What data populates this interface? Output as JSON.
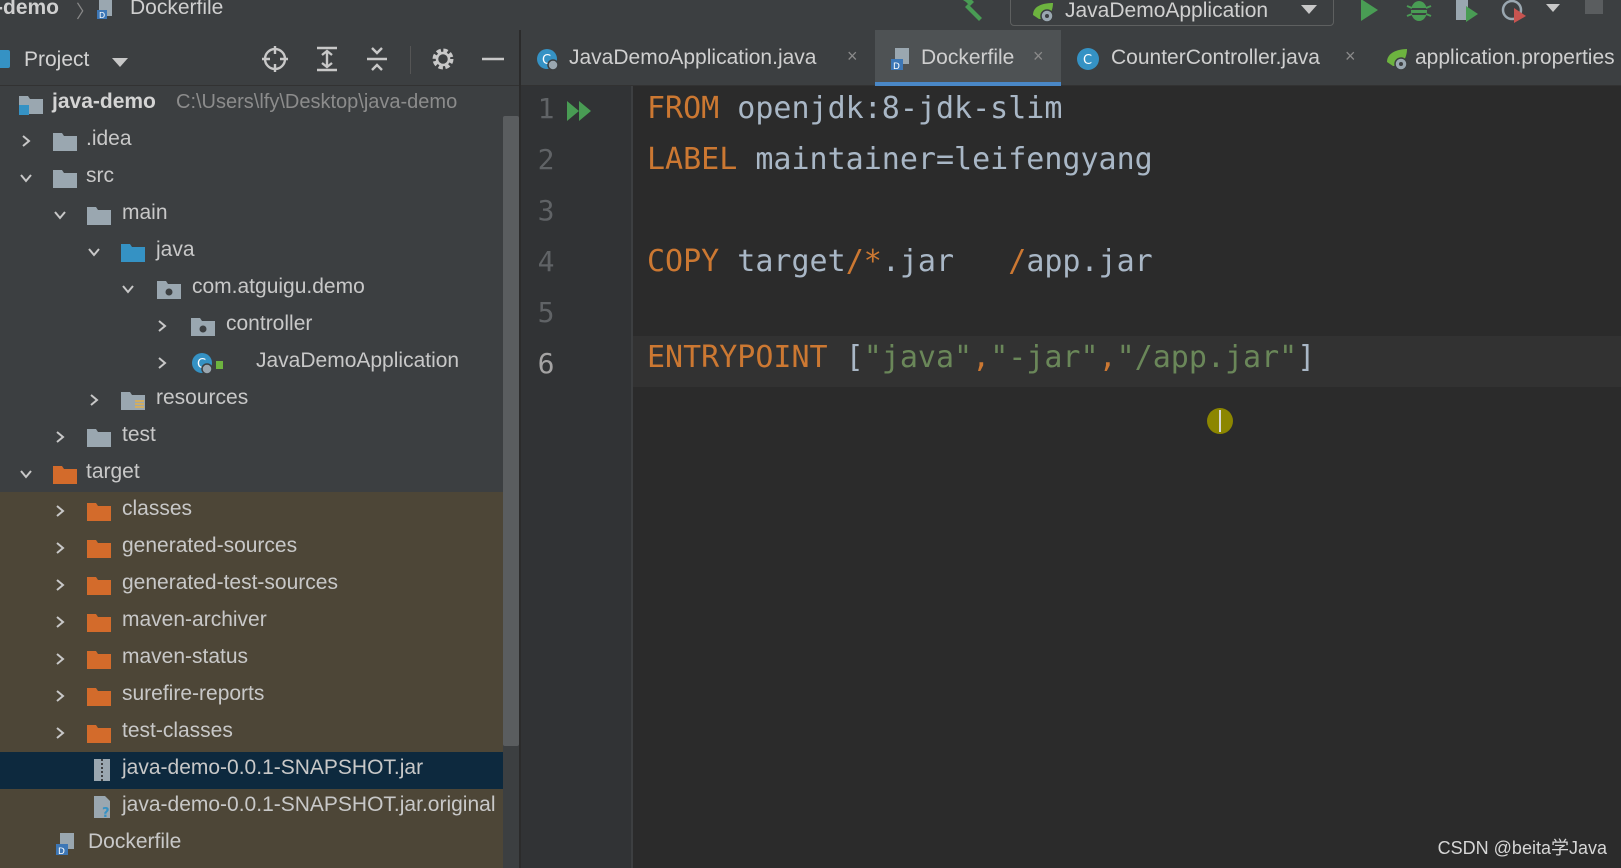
{
  "navbar": {
    "project_crumb": "-demo",
    "file_crumb": "Dockerfile",
    "run_config": "JavaDemoApplication"
  },
  "project_panel": {
    "title": "Project",
    "tree": [
      {
        "label": "java-demo",
        "path": "C:\\Users\\lfy\\Desktop\\java-demo"
      },
      {
        "label": ".idea"
      },
      {
        "label": "src"
      },
      {
        "label": "main"
      },
      {
        "label": "java"
      },
      {
        "label": "com.atguigu.demo"
      },
      {
        "label": "controller"
      },
      {
        "label": "JavaDemoApplication"
      },
      {
        "label": "resources"
      },
      {
        "label": "test"
      },
      {
        "label": "target"
      },
      {
        "label": "classes"
      },
      {
        "label": "generated-sources"
      },
      {
        "label": "generated-test-sources"
      },
      {
        "label": "maven-archiver"
      },
      {
        "label": "maven-status"
      },
      {
        "label": "surefire-reports"
      },
      {
        "label": "test-classes"
      },
      {
        "label": "java-demo-0.0.1-SNAPSHOT.jar"
      },
      {
        "label": "java-demo-0.0.1-SNAPSHOT.jar.original"
      },
      {
        "label": "Dockerfile"
      }
    ]
  },
  "tabs": [
    {
      "label": "JavaDemoApplication.java",
      "close": "×"
    },
    {
      "label": "Dockerfile",
      "close": "×"
    },
    {
      "label": "CounterController.java",
      "close": "×"
    },
    {
      "label": "application.properties"
    }
  ],
  "editor": {
    "line_numbers": [
      "1",
      "2",
      "3",
      "4",
      "5",
      "6"
    ],
    "lines": [
      {
        "kw": "FROM",
        "rest": " openjdk:8-jdk-slim"
      },
      {
        "kw": "LABEL",
        "rest": " maintainer=leifengyang"
      },
      {},
      {
        "kw": "COPY",
        "a": " target",
        "op1": "/*",
        "b": ".jar   ",
        "op2": "/",
        "c": "app.jar"
      },
      {},
      {
        "kw": "ENTRYPOINT",
        "o": " [",
        "s1": "\"java\"",
        "c1": ",",
        "s2": "\"-jar\"",
        "c2": ",",
        "s3": "\"/app.jar\"",
        "close": "]"
      }
    ]
  },
  "watermark": "CSDN @beita学Java",
  "colors": {
    "keyword": "#cc7832",
    "string": "#6a8759",
    "text": "#a9b7c6",
    "folder_target": "#d36b2b",
    "folder": "#9aa7b0",
    "source_root": "#3592c4",
    "selection": "#0d293e",
    "run_green": "#499c54"
  }
}
